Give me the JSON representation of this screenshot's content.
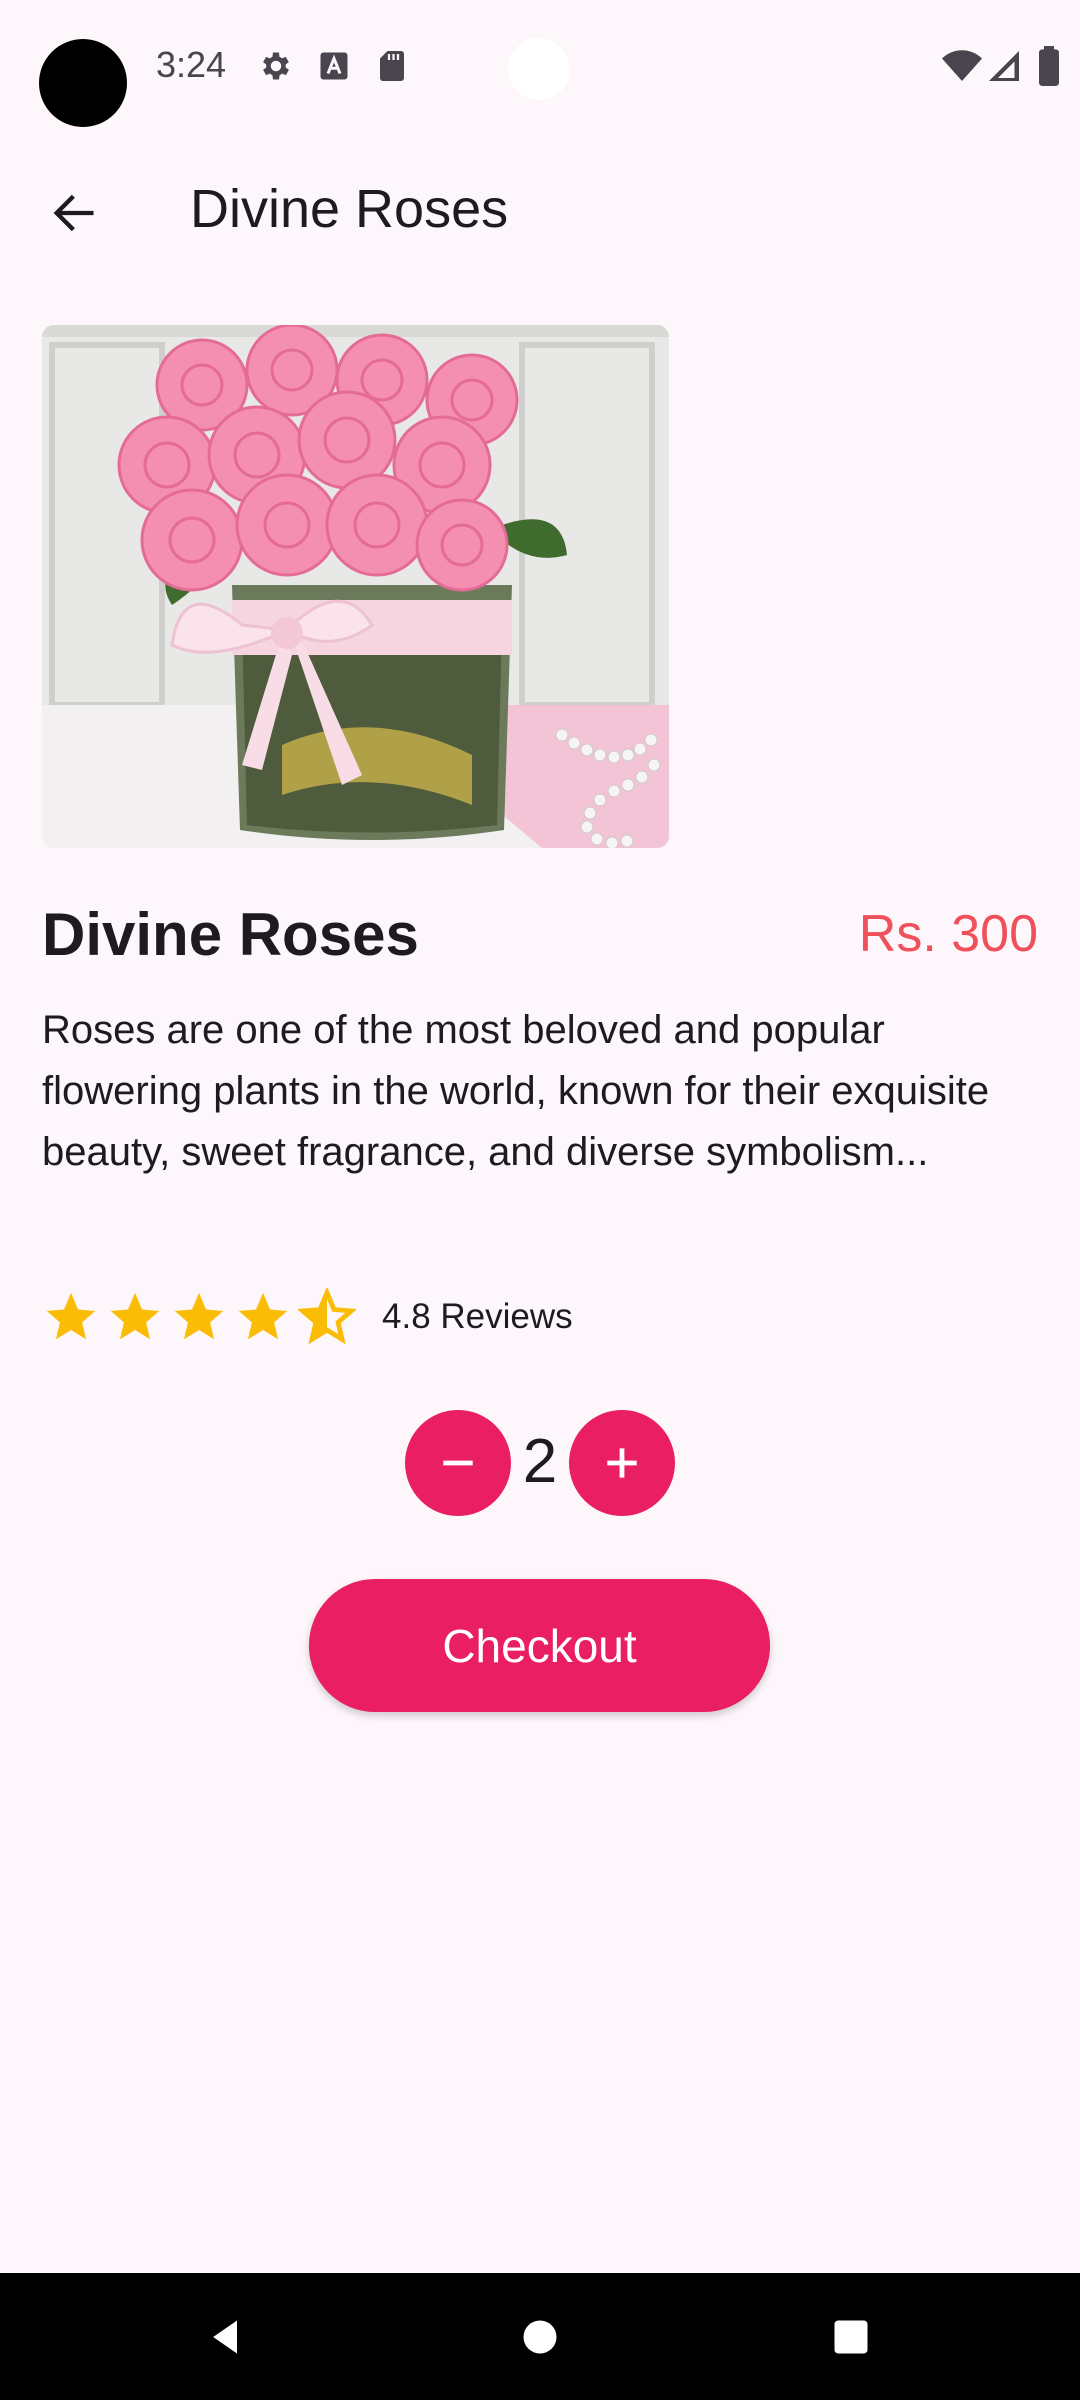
{
  "status_bar": {
    "time": "3:24",
    "icons": [
      "settings-icon",
      "font-a-icon",
      "sd-card-icon",
      "wifi-icon",
      "signal-icon",
      "battery-icon"
    ]
  },
  "app_bar": {
    "title": "Divine Roses",
    "back_icon": "arrow-back-icon"
  },
  "product": {
    "image_alt": "Pink roses in a glass vase",
    "name": "Divine Roses",
    "price": "Rs. 300",
    "description": "Roses are one of the most beloved and popular flowering plants in the world, known for their exquisite beauty, sweet fragrance, and diverse symbolism...",
    "rating": 4.8,
    "reviews_label": "4.8 Reviews"
  },
  "quantity": {
    "value": "2",
    "decrement_icon": "minus-icon",
    "increment_icon": "plus-icon"
  },
  "checkout": {
    "label": "Checkout"
  },
  "colors": {
    "accent": "#e91e63",
    "price": "#f0505a",
    "star": "#fbbc05",
    "background": "#fdf6fb"
  },
  "nav_bar": {
    "icons": [
      "back-triangle-icon",
      "home-circle-icon",
      "recents-square-icon"
    ]
  }
}
